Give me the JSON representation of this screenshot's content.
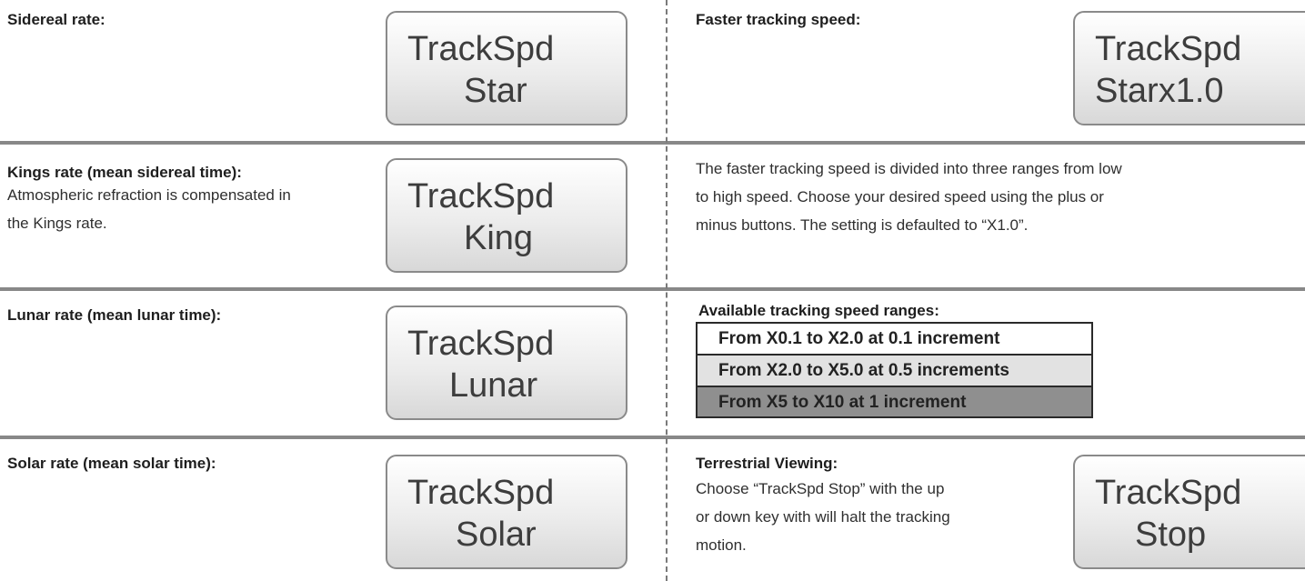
{
  "left": {
    "sidereal": {
      "heading": "Sidereal rate:",
      "lcd_line1": "TrackSpd",
      "lcd_line2": "Star"
    },
    "kings": {
      "heading": "Kings rate (mean sidereal time):",
      "desc_line1": "Atmospheric refraction is compensated in",
      "desc_line2": "the Kings rate.",
      "lcd_line1": "TrackSpd",
      "lcd_line2": "King"
    },
    "lunar": {
      "heading": "Lunar rate (mean lunar time):",
      "lcd_line1": "TrackSpd",
      "lcd_line2": "Lunar"
    },
    "solar": {
      "heading": "Solar rate (mean solar time):",
      "lcd_line1": "TrackSpd",
      "lcd_line2": "Solar"
    }
  },
  "right": {
    "faster": {
      "heading": "Faster tracking speed:",
      "lcd_line1": "TrackSpd",
      "lcd_line2": "Starx1.0"
    },
    "faster_desc": {
      "line1": "The faster tracking speed is divided into three ranges from low",
      "line2": "to high speed. Choose your desired speed using the plus or",
      "line3": "minus buttons. The setting is defaulted to “X1.0”."
    },
    "ranges": {
      "heading": "Available tracking speed ranges:",
      "rows": [
        "From X0.1 to X2.0 at 0.1 increment",
        "From X2.0 to X5.0 at 0.5 increments",
        "From X5 to X10 at 1 increment"
      ]
    },
    "terrestrial": {
      "heading": "Terrestrial Viewing:",
      "desc_line1": "Choose “TrackSpd Stop” with the up",
      "desc_line2": "or down key with will halt the tracking",
      "desc_line3": "motion.",
      "lcd_line1": "TrackSpd",
      "lcd_line2": "Stop"
    }
  },
  "colors": {
    "divider": "#888888",
    "range_row_1": "#ffffff",
    "range_row_2": "#e2e2e2",
    "range_row_3": "#8f8f8f"
  }
}
